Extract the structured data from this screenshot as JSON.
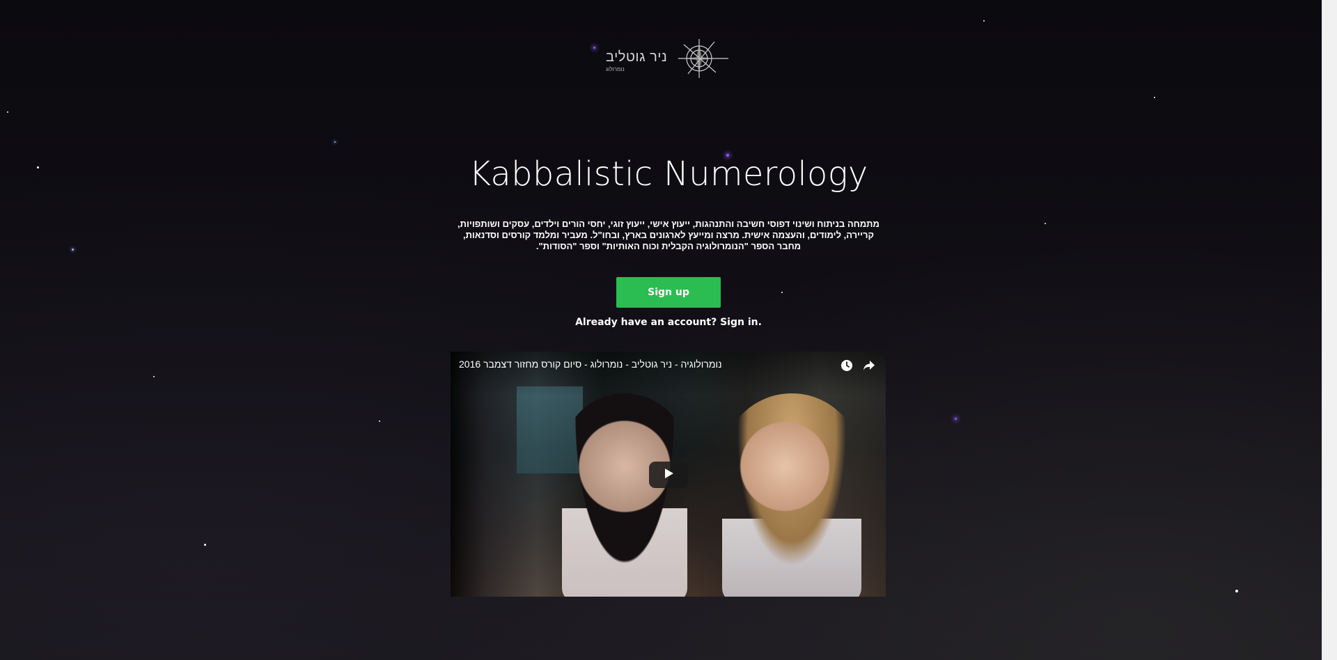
{
  "colors": {
    "accent": "#2bbd52",
    "background": "#0d0b10",
    "text": "#ffffff"
  },
  "logo": {
    "name": "ניר גוטליב",
    "subtitle": "נומרולוג",
    "icon": "compass-icon"
  },
  "hero": {
    "title": "Kabbalistic Numerology",
    "description": "מתמחה בניתוח ושינוי דפוסי חשיבה והתנהגות, ייעוץ אישי, ייעוץ זוגי, יחסי הורים וילדים, עסקים ושותפויות, קריירה, לימודים, והעצמה אישית. מרצה ומייעץ לארגונים בארץ, ובחו\"ל. מעביר ומלמד קורסים וסדנאות, מחבר הספר \"הנומרולוגיה הקבלית וכוח האותיות\" וספר \"הסודות\"."
  },
  "actions": {
    "signup_label": "Sign up",
    "signin_text": "Already have an account? Sign in."
  },
  "video": {
    "title": "נומרולוגיה - ניר גוטליב - נומרולוג - סיום קורס מחזור דצמבר 2016",
    "icons": [
      "watch-later-icon",
      "share-icon",
      "play-icon"
    ]
  }
}
